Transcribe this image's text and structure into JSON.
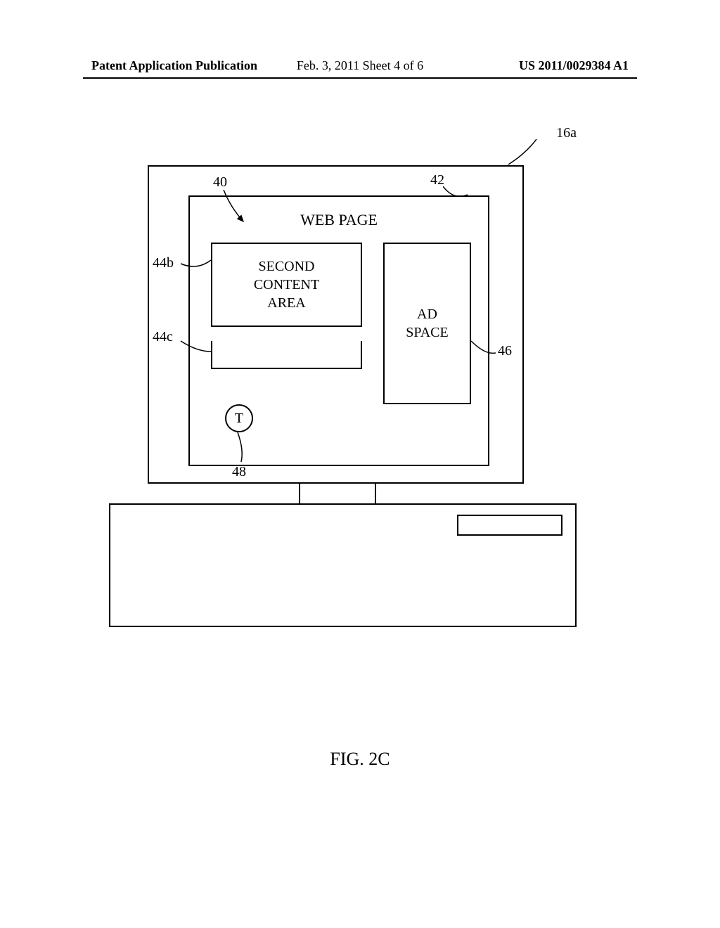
{
  "header": {
    "left": "Patent Application Publication",
    "center": "Feb. 3, 2011  Sheet 4 of 6",
    "right": "US 2011/0029384 A1"
  },
  "labels": {
    "ref_16a": "16a",
    "ref_40": "40",
    "ref_42": "42",
    "ref_44b": "44b",
    "ref_44c": "44c",
    "ref_46": "46",
    "ref_48": "48"
  },
  "webpage": {
    "title": "WEB PAGE",
    "content_area_line1": "SECOND",
    "content_area_line2": "CONTENT",
    "content_area_line3": "AREA",
    "ad_line1": "AD",
    "ad_line2": "SPACE",
    "t_label": "T"
  },
  "figure_caption": "FIG. 2C"
}
